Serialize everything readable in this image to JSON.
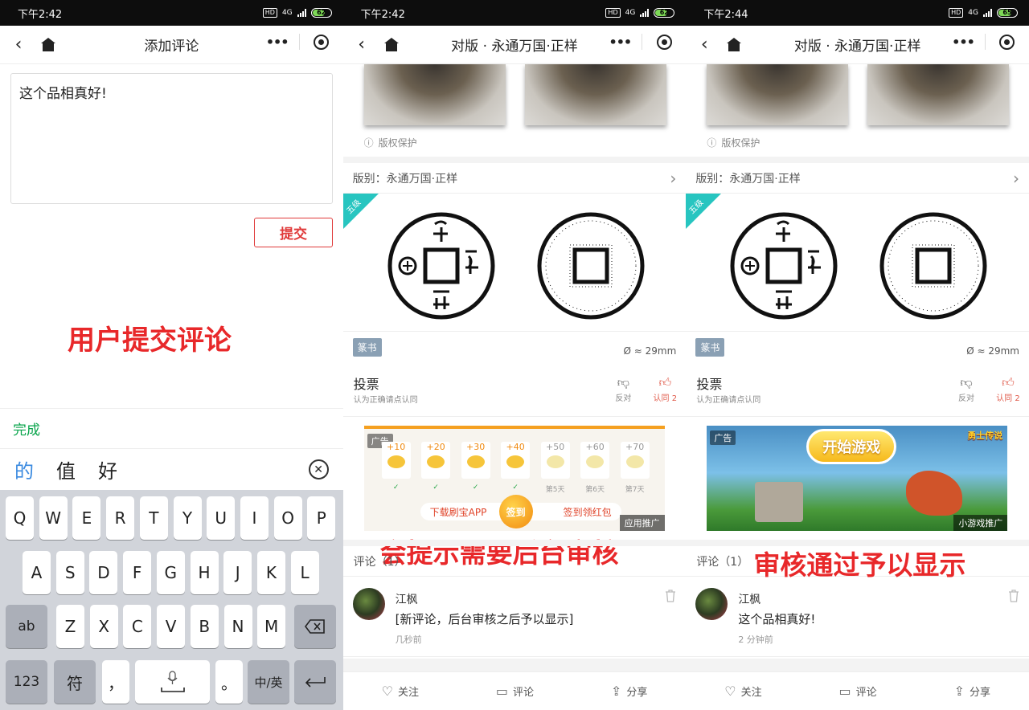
{
  "panels": [
    {
      "status_time": "下午2:42",
      "battery": "62",
      "nav_title": "添加评论",
      "comment_input_value": "这个品相真好!",
      "submit_label": "提交",
      "overlay_caption": "用户提交评论",
      "keyboard_done_label": "完成",
      "candidates": [
        "的",
        "值",
        "好"
      ],
      "keyboard": {
        "row1": [
          "Q",
          "W",
          "E",
          "R",
          "T",
          "Y",
          "U",
          "I",
          "O",
          "P"
        ],
        "row2": [
          "A",
          "S",
          "D",
          "F",
          "G",
          "H",
          "J",
          "K",
          "L"
        ],
        "row3": [
          "Z",
          "X",
          "C",
          "V",
          "B",
          "N",
          "M"
        ],
        "shift_label": "ab",
        "num_label": "123",
        "symbol_label": "符",
        "comma_label": "，",
        "period_label": "。",
        "lang_label": "中/英"
      }
    },
    {
      "status_time": "下午2:42",
      "battery": "62",
      "nav_title": "对版 · 永通万国·正样",
      "copyright_label": "版权保护",
      "version_label": "版别：永通万国·正样",
      "grade": "五级",
      "script_tag": "篆书",
      "diameter": "Ø ≈ 29mm",
      "vote": {
        "title": "投票",
        "subtitle": "认为正确请点认同",
        "oppose_label": "反对",
        "agree_label": "认同 2"
      },
      "ad": {
        "label": "广告",
        "tag": "应用推广",
        "rewards": [
          "+10",
          "+20",
          "+30",
          "+40",
          "+50",
          "+60",
          "+70"
        ],
        "days": [
          "第5天",
          "第6天",
          "第7天"
        ],
        "download_label": "下载刷宝APP",
        "signin_label": "签到",
        "redpack_label": "签到领红包"
      },
      "overlay_caption": "会提示需要后台审核",
      "comments_header": "评论（1）",
      "comment": {
        "name": "江枫",
        "body": "[新评论，后台审核之后予以显示]",
        "time": "几秒前"
      },
      "bottom": {
        "follow": "关注",
        "comment": "评论",
        "share": "分享"
      }
    },
    {
      "status_time": "下午2:44",
      "battery": "65",
      "nav_title": "对版 · 永通万国·正样",
      "copyright_label": "版权保护",
      "version_label": "版别：永通万国·正样",
      "grade": "五级",
      "script_tag": "篆书",
      "diameter": "Ø ≈ 29mm",
      "vote": {
        "title": "投票",
        "subtitle": "认为正确请点认同",
        "oppose_label": "反对",
        "agree_label": "认同 2"
      },
      "ad": {
        "label": "广告",
        "tag": "小游戏推广",
        "start_game": "开始游戏",
        "game_logo": "勇士传说"
      },
      "overlay_caption": "审核通过予以显示",
      "comments_header": "评论（1）",
      "comment": {
        "name": "江枫",
        "body": "这个品相真好!",
        "time": "2 分钟前"
      },
      "bottom": {
        "follow": "关注",
        "comment": "评论",
        "share": "分享"
      }
    }
  ],
  "colors": {
    "accent_red": "#e8282a",
    "teal_badge": "#27c5c0",
    "done_green": "#08a44b",
    "candidate_blue": "#3a8ae0",
    "vote_red": "#e05a4a"
  }
}
